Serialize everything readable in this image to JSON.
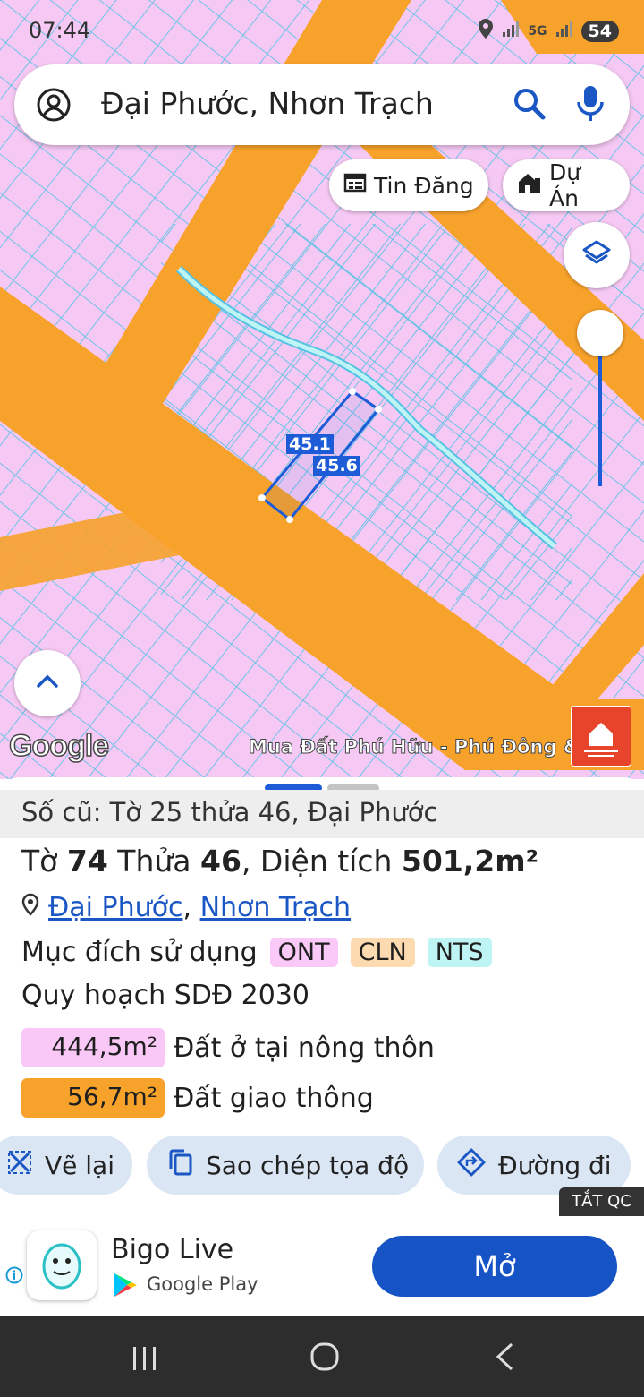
{
  "status_bar": {
    "time": "07:44",
    "network": "5G",
    "battery": "54"
  },
  "search": {
    "query": "Đại Phước, Nhơn Trạch"
  },
  "chips": {
    "listings": "Tin Đăng",
    "projects": "Dự Án"
  },
  "map": {
    "edge_label_1": "45.1",
    "edge_label_2": "45.6",
    "google_logo": "Google",
    "ad_caption": "Mua Đất Phú Hữu - Phú Đông &"
  },
  "sheet": {
    "old_number": "Số cũ: Tờ 25 thửa 46, Đại Phước",
    "sheet_prefix": "Tờ",
    "sheet_no": "74",
    "parcel_prefix": "Thửa",
    "parcel_no": "46",
    "area_prefix": ", Diện tích",
    "area": "501,2m²",
    "commune": "Đại Phước",
    "district": "Nhơn Trạch",
    "loc_sep": ",",
    "purpose_label": "Mục đích sử dụng",
    "purpose_tags": [
      {
        "code": "ONT",
        "color": "#fbc9f7"
      },
      {
        "code": "CLN",
        "color": "#fddab0"
      },
      {
        "code": "NTS",
        "color": "#bff4f4"
      }
    ],
    "plan_title": "Quy hoạch SDĐ 2030",
    "zones": [
      {
        "area": "444,5m²",
        "label": "Đất ở tại nông thôn",
        "color": "#f9c8f7"
      },
      {
        "area": "56,7m²",
        "label": "Đất giao thông",
        "color": "#f7a22b"
      }
    ]
  },
  "actions": {
    "redraw": "Vẽ lại",
    "copy_coords": "Sao chép tọa độ",
    "directions": "Đường đi"
  },
  "ad": {
    "close_label": "TẮT QC",
    "app_name": "Bigo Live",
    "store": "Google Play",
    "open_button": "Mở"
  },
  "colors": {
    "map_pink": "#f6c9f4",
    "road_orange": "#f7a22b",
    "parcel_line": "#55c2e3",
    "accent_blue": "#1a56c4"
  }
}
